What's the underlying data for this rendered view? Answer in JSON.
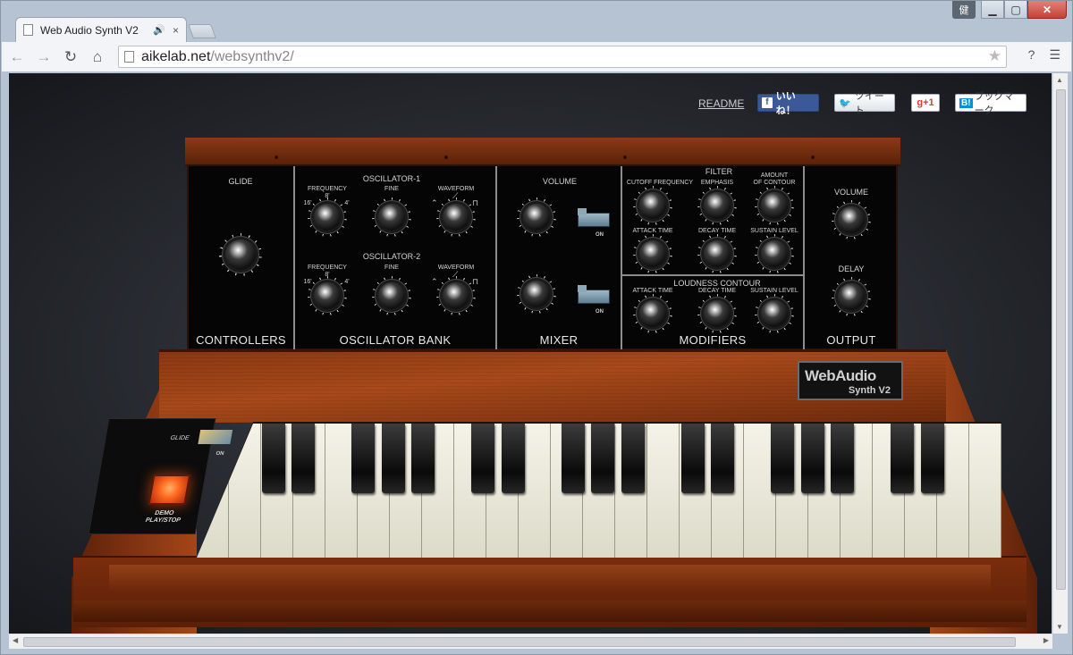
{
  "browser": {
    "tab_title": "Web Audio Synth V2",
    "tab_audio_icon": "speaker-icon",
    "tab_close": "×",
    "url_host": "aikelab.net",
    "url_path": "/websynthv2/",
    "window_user_badge": "健",
    "window_min": "▁",
    "window_max": "▢",
    "window_close": "✕",
    "nav_back": "←",
    "nav_forward": "→",
    "nav_reload": "↻",
    "nav_home": "⌂",
    "bookmark_star": "★",
    "help": "?"
  },
  "page": {
    "readme": "README",
    "like": "いいね！",
    "tweet": "ツイート",
    "gplus": "g+1",
    "hatena_icon": "B!",
    "hatena": "ブックマーク"
  },
  "synth": {
    "sections": {
      "controllers": "CONTROLLERS",
      "oscillator_bank": "OSCILLATOR BANK",
      "mixer": "MIXER",
      "modifiers": "MODIFIERS",
      "output": "OUTPUT"
    },
    "controllers": {
      "glide": "GLIDE"
    },
    "osc1": {
      "title": "OSCILLATOR-1",
      "frequency": "FREQUENCY",
      "fine": "FINE",
      "waveform": "WAVEFORM",
      "f16": "16'",
      "f8": "8'",
      "f4": "4'"
    },
    "osc2": {
      "title": "OSCILLATOR-2",
      "frequency": "FREQUENCY",
      "fine": "FINE",
      "waveform": "WAVEFORM",
      "f16": "16'",
      "f8": "8'",
      "f4": "4'"
    },
    "mixer": {
      "volume": "VOLUME",
      "on1": "ON",
      "on2": "ON"
    },
    "filter": {
      "title": "FILTER",
      "cutoff": "CUTOFF FREQUENCY",
      "emphasis": "EMPHASIS",
      "amount": "AMOUNT",
      "amount2": "OF CONTOUR",
      "attack": "ATTACK TIME",
      "decay": "DECAY TIME",
      "sustain": "SUSTAIN LEVEL"
    },
    "loudness": {
      "title": "LOUDNESS CONTOUR",
      "attack": "ATTACK TIME",
      "decay": "DECAY TIME",
      "sustain": "SUSTAIN LEVEL"
    },
    "output": {
      "volume": "VOLUME",
      "delay": "DELAY"
    },
    "badge": {
      "line1": "WebAudio",
      "line2": "Synth V2"
    },
    "keyboard": {
      "glide": "GLIDE",
      "glide_on": "ON",
      "demo_line1": "DEMO",
      "demo_line2": "PLAY/STOP"
    }
  }
}
